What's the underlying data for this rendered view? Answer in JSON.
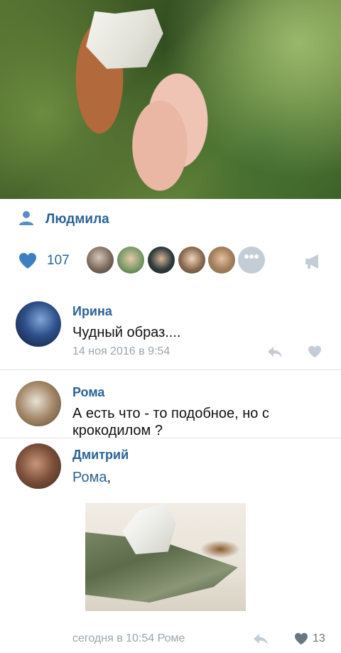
{
  "post": {
    "author": "Людмила",
    "likes_count": "107"
  },
  "comments": [
    {
      "name": "Ирина",
      "text": "Чудный образ....",
      "meta": "14 ноя 2016 в 9:54"
    },
    {
      "name": "Рома",
      "text": "А есть что - то подобное, но с крокодилом ?"
    },
    {
      "name": "Дмитрий",
      "mention": "Рома",
      "text_suffix": ",",
      "meta": "сегодня в 10:54 Роме",
      "likes": "13"
    }
  ],
  "colors": {
    "accent": "#2a6496",
    "meta": "#9aa4ad",
    "icon_muted": "#c4ccd6",
    "like_heart": "#3d7fbf"
  },
  "icons": [
    "person-icon",
    "heart-icon",
    "more-icon",
    "megaphone-icon",
    "reply-icon"
  ]
}
